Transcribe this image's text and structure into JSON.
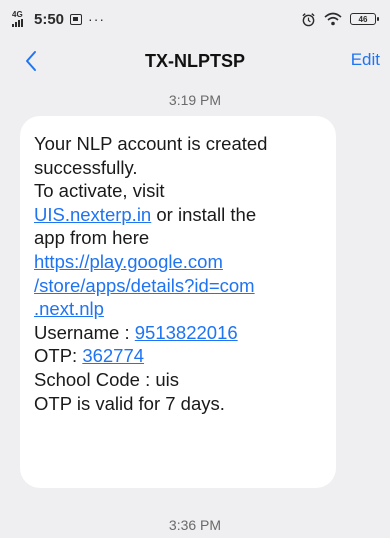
{
  "status_bar": {
    "network_label": "4G",
    "time": "5:50",
    "more_indicator": "···",
    "battery_level": "46"
  },
  "header": {
    "title": "TX-NLPTSP",
    "edit_label": "Edit"
  },
  "messages": [
    {
      "timestamp": "3:19 PM",
      "text_lines": {
        "l1": "Your NLP account is created",
        "l2": "successfully.",
        "l3": "To activate, visit",
        "l4_link": "UIS.nexterp.in",
        "l4_rest": " or install the",
        "l5": "app from here",
        "l6_link": "https://play.google.com",
        "l7_link": "/store/apps/details?id=com",
        "l8_link": ".next.nlp",
        "l9_label": "Username : ",
        "l9_link": "9513822016",
        "l10_label": "OTP: ",
        "l10_link": "362774",
        "l11": "School Code : uis",
        "l12": "OTP is valid for 7 days."
      }
    },
    {
      "timestamp": "3:36 PM"
    }
  ],
  "colors": {
    "background": "#efeff1",
    "bubble": "#ffffff",
    "link": "#1f74f2"
  }
}
